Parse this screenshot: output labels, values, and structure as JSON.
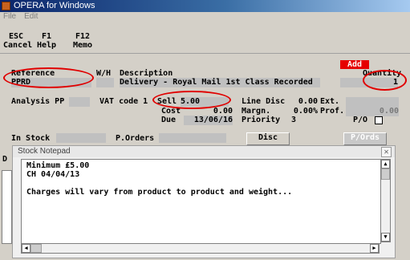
{
  "window": {
    "title": "OPERA for Windows"
  },
  "menu": [
    "File",
    "Edit"
  ],
  "toolbar": [
    {
      "key": "ESC",
      "label": "Cancel"
    },
    {
      "key": "F1",
      "label": "Help"
    },
    {
      "key": "F12",
      "label": "Memo"
    }
  ],
  "form": {
    "add_badge": "Add",
    "reference_label": "Reference",
    "wh_label": "W/H",
    "description_label": "Description",
    "quantity_label": "Quantity",
    "reference_value": "PPRD",
    "description_value": "Delivery - Royal Mail 1st Class Recorded",
    "quantity_value": "1",
    "analysis_label": "Analysis PP",
    "vat_label": "VAT code 1",
    "sell_label": "Sell",
    "sell_value": "5.00",
    "cost_label": "Cost",
    "cost_value": "0.00",
    "due_label": "Due",
    "due_value": "13/06/16",
    "line_disc_label": "Line Disc",
    "line_disc_value": "0.00",
    "margin_label": "Margn.",
    "margin_value": "0.00%",
    "priority_label": "Priority",
    "priority_value": "3",
    "ext_label": "Ext.",
    "prof_label": "Prof.",
    "prof_value": "0.00",
    "po_label": "P/O",
    "in_stock_label": "In Stock",
    "porders_label": "P.Orders",
    "disc_button": "Disc",
    "pords_button": "P/Ords",
    "side_letter": "D"
  },
  "notepad": {
    "title": "Stock Notepad",
    "lines": [
      "Minimum £5.00",
      "CH 04/04/13",
      "",
      "Charges will vary from product to product and weight..."
    ]
  },
  "colors": {
    "annotation": "#e00000",
    "titlebar": "#0a246a"
  }
}
